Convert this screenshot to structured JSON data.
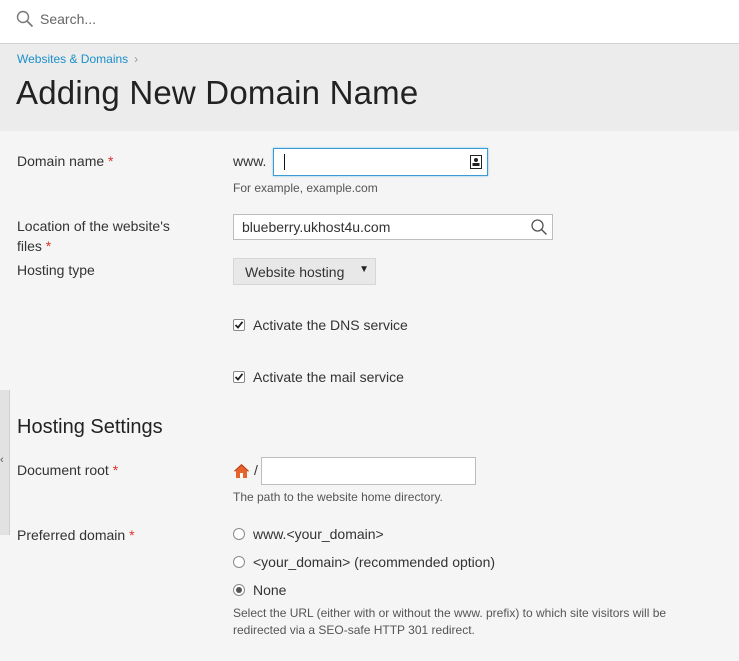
{
  "search": {
    "placeholder": "Search...",
    "icon": "search-icon"
  },
  "breadcrumb": {
    "link": "Websites & Domains",
    "separator": "›"
  },
  "page_title": "Adding New Domain Name",
  "form": {
    "domain_name": {
      "label": "Domain name",
      "required": "*",
      "prefix": "www.",
      "value": "",
      "hint": "For example, example.com"
    },
    "location": {
      "label_line1": "Location of the website's",
      "label_line2": "files",
      "required": "*",
      "value": "blueberry.ukhost4u.com"
    },
    "hosting_type": {
      "label": "Hosting type",
      "selected": "Website hosting",
      "arrow": "▼"
    },
    "dns": {
      "label": "Activate the DNS service",
      "checked": true
    },
    "mail": {
      "label": "Activate the mail service",
      "checked": true
    }
  },
  "hosting_settings": {
    "title": "Hosting Settings",
    "document_root": {
      "label": "Document root",
      "required": "*",
      "slash": "/",
      "value": "",
      "hint": "The path to the website home directory."
    },
    "preferred_domain": {
      "label": "Preferred domain",
      "required": "*",
      "options": [
        {
          "label": "www.<your_domain>",
          "checked": false
        },
        {
          "label": "<your_domain> (recommended option)",
          "checked": false
        },
        {
          "label": "None",
          "checked": true
        }
      ],
      "hint_line1": "Select the URL (either with or without the www. prefix) to which site visitors will be",
      "hint_line2": "redirected via a SEO-safe HTTP 301 redirect."
    }
  },
  "side_tab": {
    "chevron": "‹"
  },
  "colors": {
    "link": "#1a8fc9",
    "required": "#d9342b",
    "focus_border": "#3c9bd5",
    "home_icon": "#e8632b"
  }
}
